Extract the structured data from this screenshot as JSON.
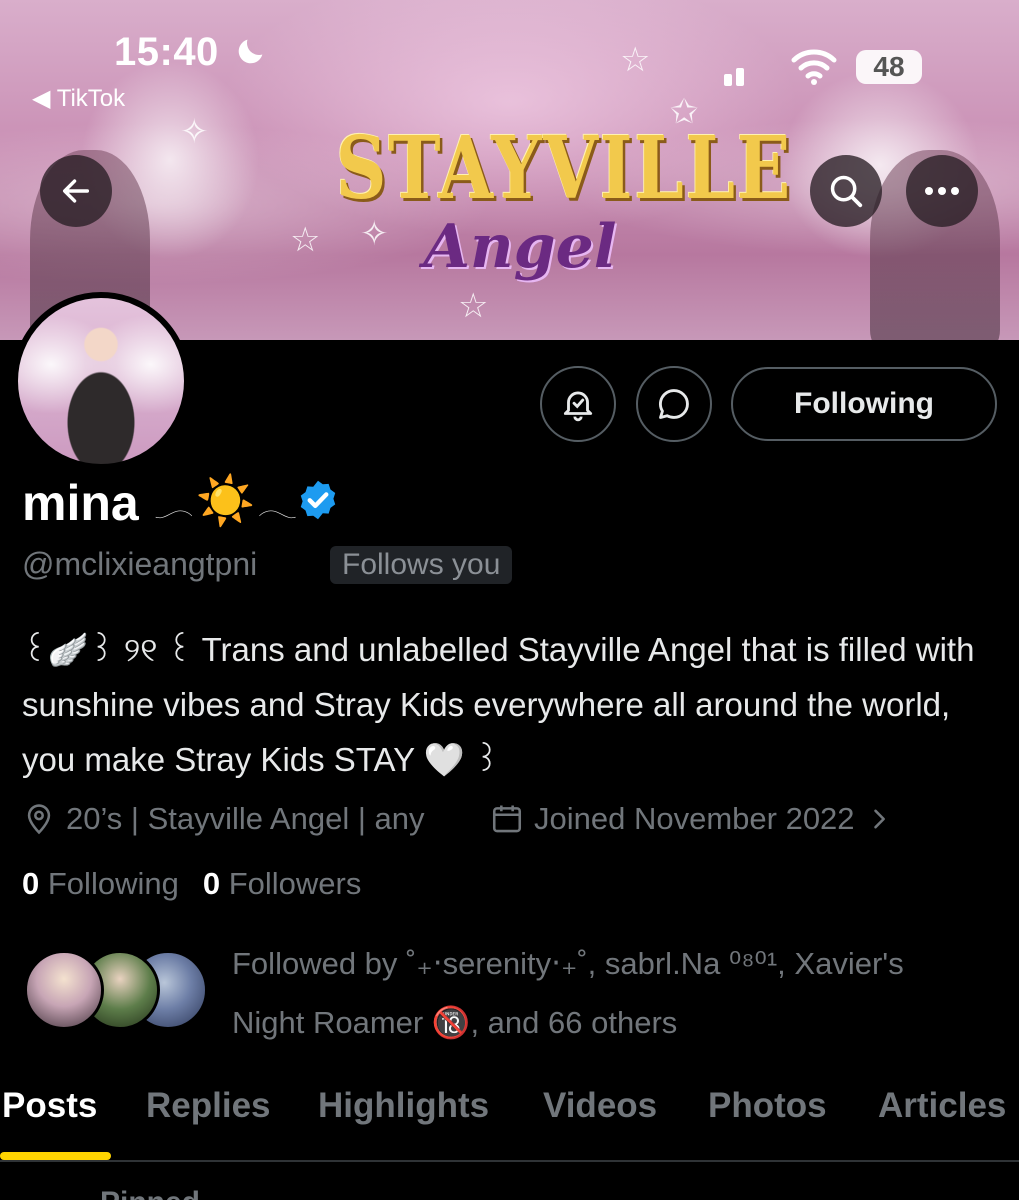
{
  "status_bar": {
    "time": "15:40",
    "back_app": "◀ TikTok",
    "battery": "48"
  },
  "banner": {
    "title": "STAYVILLE",
    "subtitle": "Angel"
  },
  "profile": {
    "name": "mina",
    "name_emoji_left": "𓂃",
    "name_emoji_center": "☀️",
    "name_emoji_right": "𓂃",
    "handle": "@mclixieangtpni",
    "follows_you": "Follows you",
    "bio": "꒰🪽꒱ ୨୧ ꒰ Trans and unlabelled Stayville Angel that is filled with sunshine vibes and Stray Kids everywhere all around the world, you make Stray Kids STAY 🤍 ꒱",
    "location": "20’s | Stayville Angel | any",
    "joined": "Joined November 2022",
    "following_count": "0",
    "following_label": "Following",
    "followers_count": "0",
    "followers_label": "Followers",
    "followed_by_line1": "Followed by ˚₊‧serenity‧₊˚, sabrl.Na ⁰⁸⁰¹, Xavier's",
    "followed_by_line2": "Night Roamer 🔞, and 66 others"
  },
  "actions": {
    "following_button": "Following"
  },
  "tabs": [
    "Posts",
    "Replies",
    "Highlights",
    "Videos",
    "Photos",
    "Articles"
  ],
  "pinned_label": "Pinned",
  "colors": {
    "background": "#000000",
    "accent_tab_indicator": "#ffd400",
    "verified": "#1d9bf0",
    "muted_text": "#71767b"
  },
  "icons": [
    "moon-icon",
    "signal-icon",
    "wifi-icon",
    "back-arrow-icon",
    "search-icon",
    "more-icon",
    "notification-bell-icon",
    "message-icon",
    "verified-icon",
    "location-icon",
    "calendar-icon",
    "chevron-right-icon"
  ]
}
